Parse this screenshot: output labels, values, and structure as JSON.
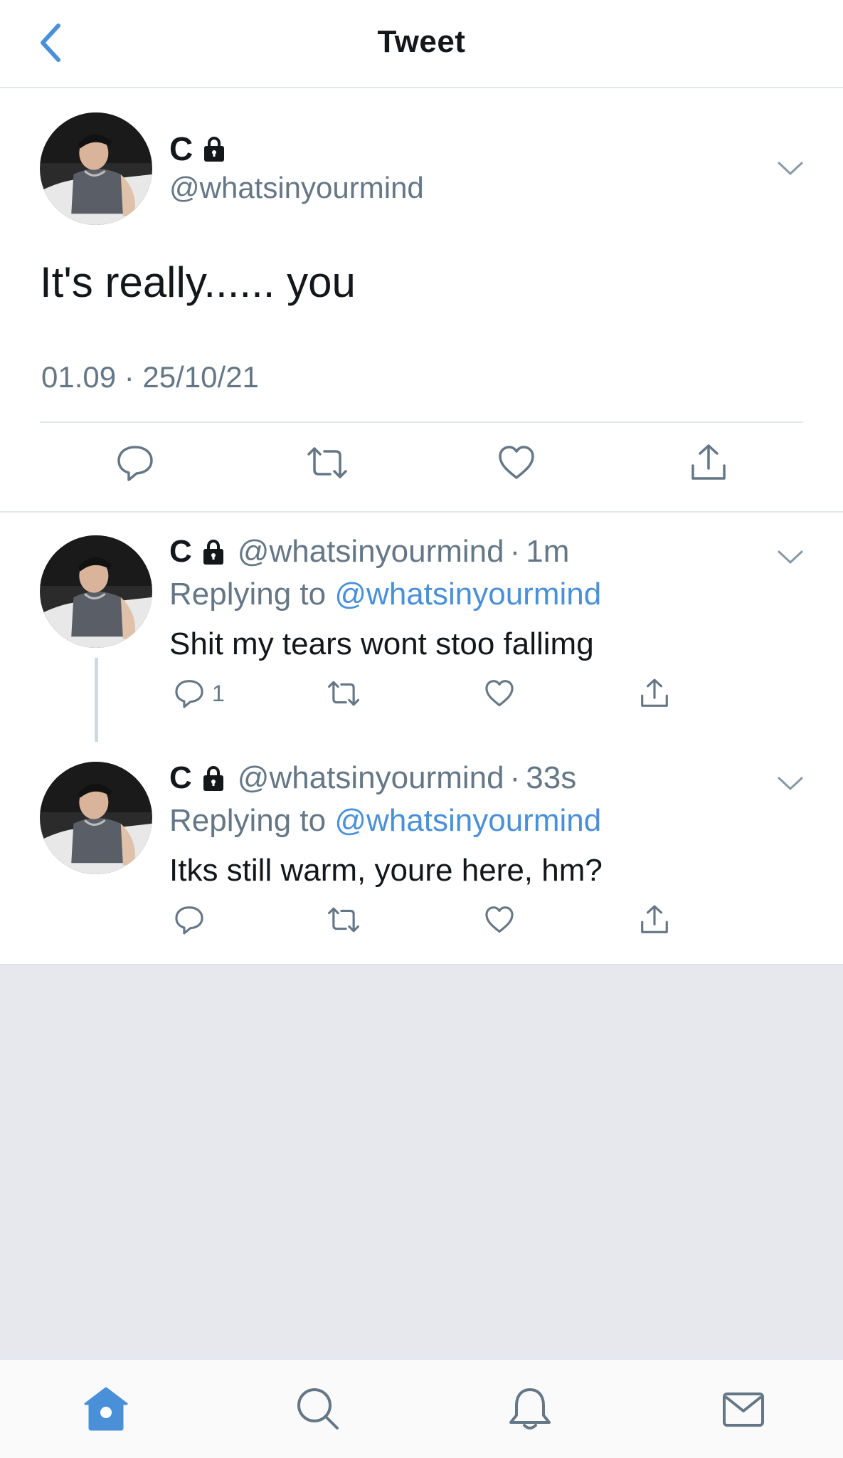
{
  "header": {
    "title": "Tweet",
    "back_icon": "chevron-left-icon"
  },
  "colors": {
    "accent": "#4a90d9",
    "secondary_text": "#657786",
    "divider": "#e1e8ed",
    "empty_background": "#e6e8ed"
  },
  "main_tweet": {
    "name": "C",
    "handle": "@whatsinyourmind",
    "text": "It's really...... you",
    "timestamp": "01.09 · 25/10/21",
    "actions": [
      "comment-icon",
      "retweet-icon",
      "like-icon",
      "share-icon"
    ]
  },
  "replies": [
    {
      "name": "C",
      "handle": "@whatsinyourmind",
      "dot": "·",
      "time": "1m",
      "replying_prefix": "Replying to",
      "replying_handle": "@whatsinyourmind",
      "text": "Shit my tears wont stoo fallimg",
      "reply_count": "1"
    },
    {
      "name": "C",
      "handle": "@whatsinyourmind",
      "dot": "·",
      "time": "33s",
      "replying_prefix": "Replying to",
      "replying_handle": "@whatsinyourmind",
      "text": "Itks still warm, youre here, hm?",
      "reply_count": ""
    }
  ],
  "tabbar": {
    "tabs": [
      "home-icon",
      "search-icon",
      "notifications-icon",
      "messages-icon"
    ],
    "active": "home-icon"
  }
}
